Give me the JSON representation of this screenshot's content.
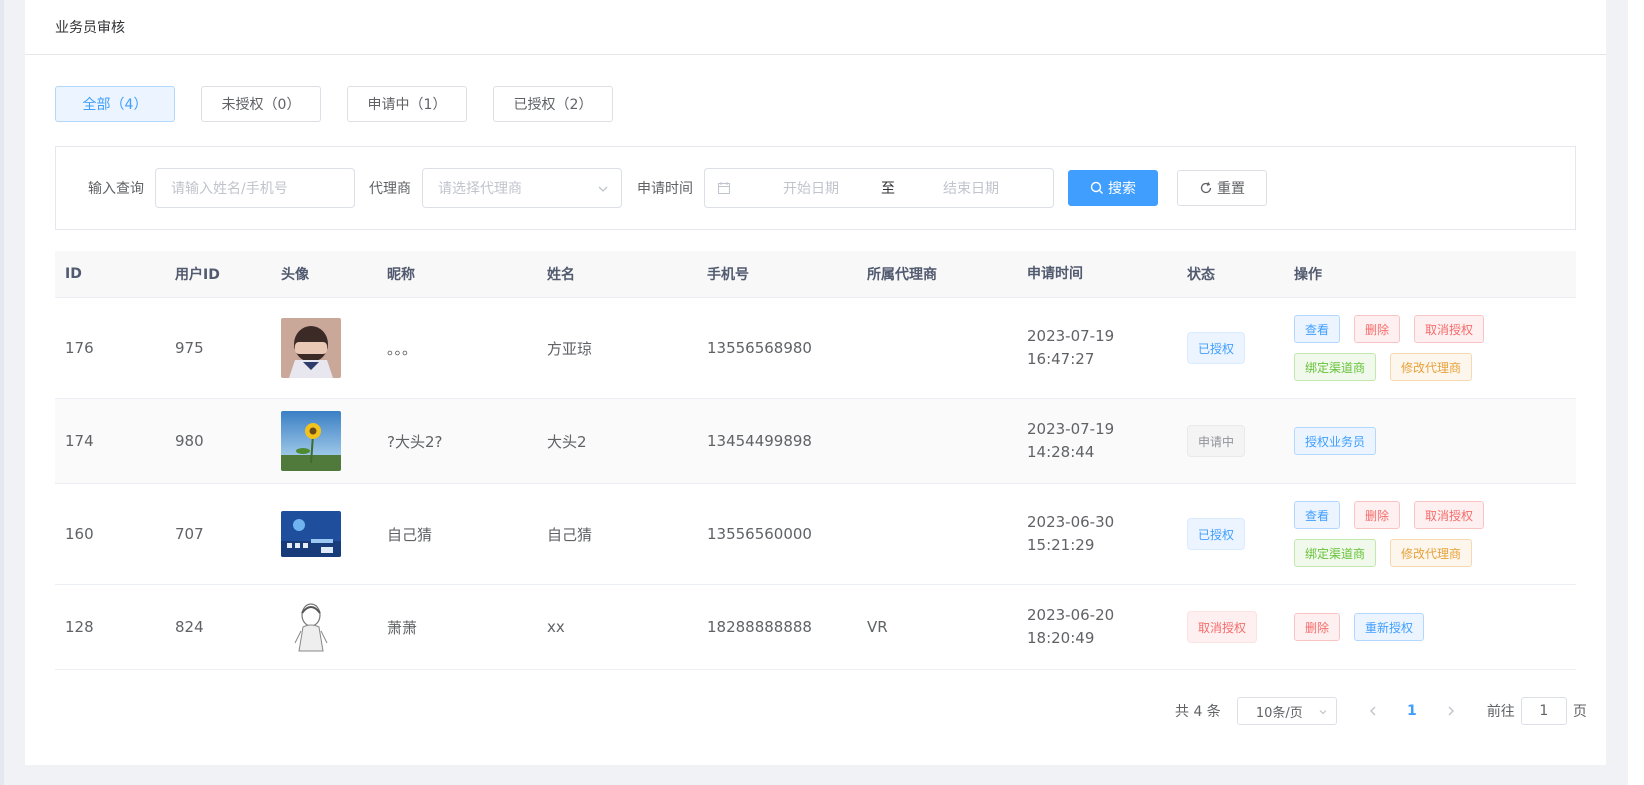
{
  "header": {
    "title": "业务员审核"
  },
  "tabs": [
    {
      "label": "全部（4）",
      "active": true
    },
    {
      "label": "未授权（0）",
      "active": false
    },
    {
      "label": "申请中（1）",
      "active": false
    },
    {
      "label": "已授权（2）",
      "active": false
    }
  ],
  "filter": {
    "query_label": "输入查询",
    "query_placeholder": "请输入姓名/手机号",
    "agent_label": "代理商",
    "agent_placeholder": "请选择代理商",
    "time_label": "申请时间",
    "start_placeholder": "开始日期",
    "range_sep": "至",
    "end_placeholder": "结束日期",
    "search_label": "搜索",
    "reset_label": "重置"
  },
  "table": {
    "columns": [
      "ID",
      "用户ID",
      "头像",
      "昵称",
      "姓名",
      "手机号",
      "所属代理商",
      "申请时间",
      "状态",
      "操作"
    ],
    "rows": [
      {
        "id": "176",
        "uid": "975",
        "avatar": "photo-person",
        "nickname": "。。。",
        "name": "方亚琼",
        "phone": "13556568980",
        "agent": "",
        "date": "2023-07-19",
        "time": "16:47:27",
        "status": "已授权",
        "ops": [
          "查看",
          "删除",
          "取消授权",
          "绑定渠道商",
          "修改代理商"
        ]
      },
      {
        "id": "174",
        "uid": "980",
        "avatar": "photo-sunflower",
        "nickname": "?大头2?",
        "name": "大头2",
        "phone": "13454499898",
        "agent": "",
        "date": "2023-07-19",
        "time": "14:28:44",
        "status": "申请中",
        "ops": [
          "授权业务员"
        ]
      },
      {
        "id": "160",
        "uid": "707",
        "avatar": "photo-screen",
        "nickname": "自己猜",
        "name": "自己猜",
        "phone": "13556560000",
        "agent": "",
        "date": "2023-06-30",
        "time": "15:21:29",
        "status": "已授权",
        "ops": [
          "查看",
          "删除",
          "取消授权",
          "绑定渠道商",
          "修改代理商"
        ]
      },
      {
        "id": "128",
        "uid": "824",
        "avatar": "photo-sketch",
        "nickname": "萧萧",
        "name": "xx",
        "phone": "18288888888",
        "agent": "VR",
        "date": "2023-06-20",
        "time": "18:20:49",
        "status": "取消授权",
        "ops": [
          "删除",
          "重新授权"
        ]
      }
    ]
  },
  "pagination": {
    "total": "共 4 条",
    "page_size": "10条/页",
    "current": "1",
    "goto_label": "前往",
    "goto_value": "1",
    "page_suffix": "页"
  }
}
